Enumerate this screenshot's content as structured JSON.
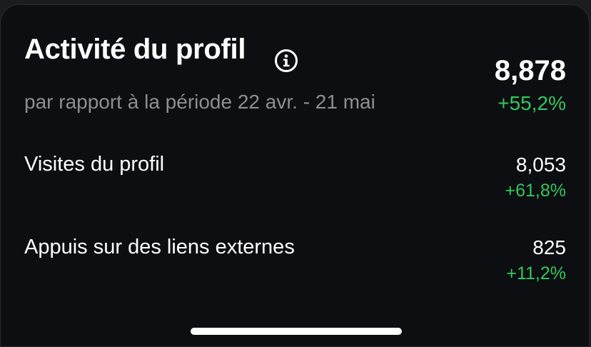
{
  "header": {
    "title": "Activité du profil",
    "subtitle": "par rapport à la période 22 avr. - 21 mai",
    "info_icon": "info-circle-icon"
  },
  "summary": {
    "total": "8,878",
    "change": "+55,2%"
  },
  "metrics": [
    {
      "label": "Visites du profil",
      "value": "8,053",
      "change": "+61,8%"
    },
    {
      "label": "Appuis sur des liens externes",
      "value": "825",
      "change": "+11,2%"
    }
  ],
  "colors": {
    "background": "#0c0e12",
    "positive": "#34c759",
    "secondary_text": "#8e8e93",
    "primary_text": "#ffffff"
  }
}
